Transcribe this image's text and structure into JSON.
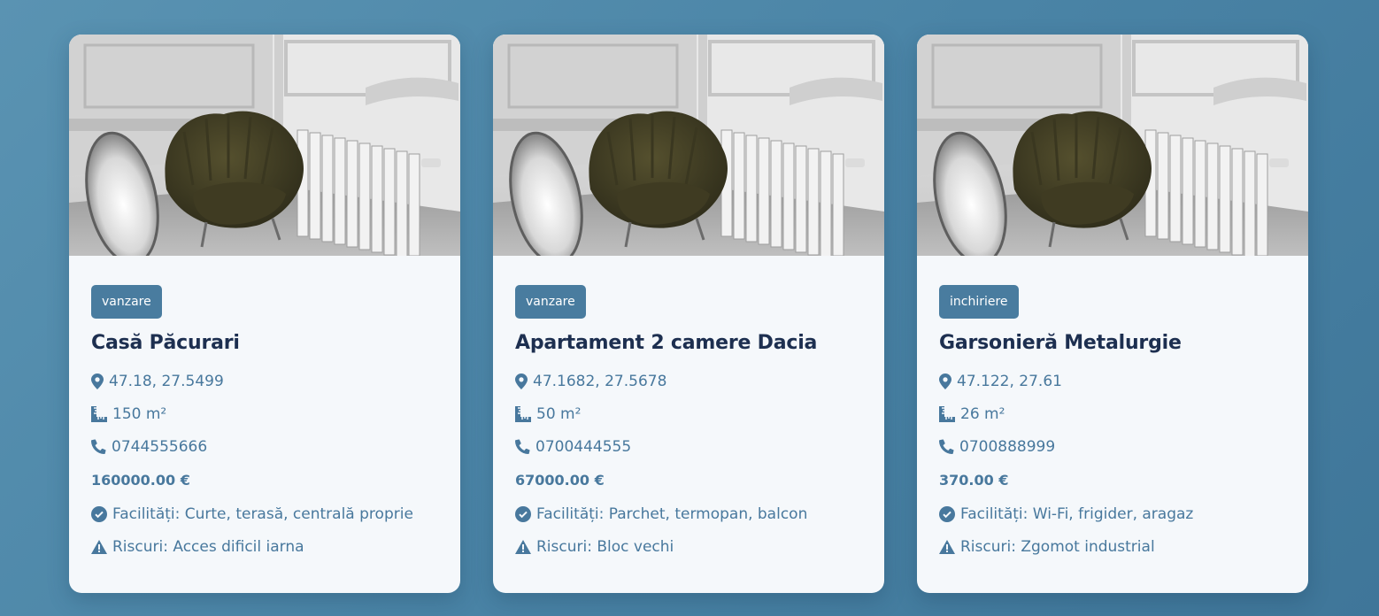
{
  "listings": [
    {
      "badge": "vanzare",
      "title": "Casă Păcurari",
      "coords": "47.18, 27.5499",
      "area": "150 m²",
      "phone": "0744555666",
      "price": "160000.00 €",
      "facilities": "Facilități: Curte, terasă, centrală proprie",
      "risks": "Riscuri: Acces dificil iarna"
    },
    {
      "badge": "vanzare",
      "title": "Apartament 2 camere Dacia",
      "coords": "47.1682, 27.5678",
      "area": "50 m²",
      "phone": "0700444555",
      "price": "67000.00 €",
      "facilities": "Facilități: Parchet, termopan, balcon",
      "risks": "Riscuri: Bloc vechi"
    },
    {
      "badge": "inchiriere",
      "title": "Garsonieră Metalurgie",
      "coords": "47.122, 27.61",
      "area": "26 m²",
      "phone": "0700888999",
      "price": "370.00 €",
      "facilities": "Facilități: Wi-Fi, frigider, aragaz",
      "risks": "Riscuri: Zgomot industrial"
    }
  ],
  "colors": {
    "accent": "#497c9f",
    "title": "#1d2f50",
    "text": "#48789d",
    "card": "#f5f8fb"
  },
  "icons": {
    "location": "map-marker-icon",
    "area": "ruler-icon",
    "phone": "phone-icon",
    "facilities": "check-circle-icon",
    "risks": "warning-icon"
  }
}
